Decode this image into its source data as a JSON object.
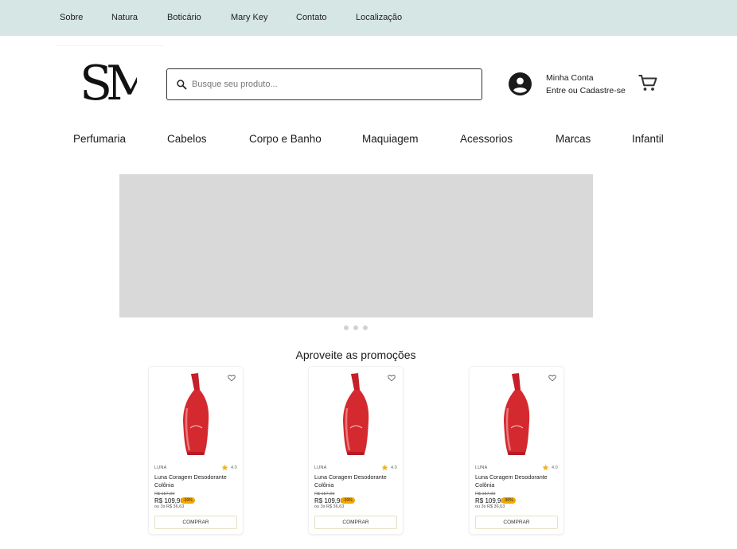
{
  "topnav": {
    "links": [
      "Sobre",
      "Natura",
      "Boticário",
      "Mary Key",
      "Contato",
      "Localização"
    ]
  },
  "header": {
    "logo_text": "SM",
    "search_placeholder": "Busque seu produto...",
    "account_line1": "Minha Conta",
    "account_line2": "Entre ou Cadastre-se",
    "icons": {
      "search": "search-icon",
      "account": "account-circle-icon",
      "cart": "cart-icon"
    }
  },
  "categories": [
    "Perfumaria",
    "Cabelos",
    "Corpo e Banho",
    "Maquiagem",
    "Acessorios",
    "Marcas",
    "Infantil"
  ],
  "carousel": {
    "dots": 3
  },
  "promotions": {
    "title": "Aproveite as promoções",
    "products": [
      {
        "brand": "LUNA",
        "rating": "4.0",
        "name": "Luna Coragem Desodorante Colônia",
        "old_price": "R$ 157,90",
        "price": "R$ 109,90",
        "discount": "-30%",
        "installments": "ou 3x R$ 36,63",
        "button": "COMPRAR"
      },
      {
        "brand": "LUNA",
        "rating": "4.0",
        "name": "Luna Coragem Desodorante Colônia",
        "old_price": "R$ 157,90",
        "price": "R$ 109,90",
        "discount": "-30%",
        "installments": "ou 3x R$ 36,63",
        "button": "COMPRAR"
      },
      {
        "brand": "LUNA",
        "rating": "4.0",
        "name": "Luna Coragem Desodorante Colônia",
        "old_price": "R$ 157,90",
        "price": "R$ 109,90",
        "discount": "-30%",
        "installments": "ou 3x R$ 36,63",
        "button": "COMPRAR"
      }
    ]
  },
  "colors": {
    "topbar_bg": "#d6e6e5",
    "banner_bg": "#d9d9d9",
    "star": "#f2b21b",
    "discount_badge": "#f2a900",
    "bottle": "#d42a2f"
  }
}
